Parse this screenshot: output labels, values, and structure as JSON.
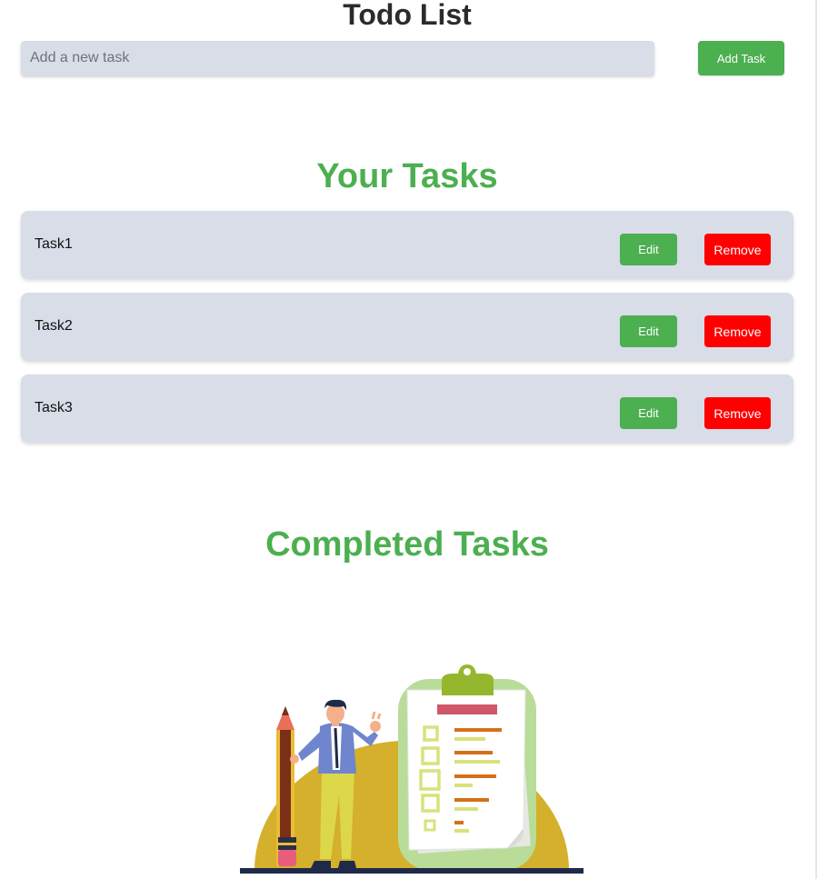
{
  "app": {
    "title": "Todo List"
  },
  "add_form": {
    "placeholder": "Add a new task",
    "value": "",
    "button_label": "Add Task"
  },
  "sections": {
    "your_tasks": "Your Tasks",
    "completed_tasks": "Completed Tasks"
  },
  "tasks": [
    {
      "name": "Task1",
      "edit_label": "Edit",
      "remove_label": "Remove"
    },
    {
      "name": "Task2",
      "edit_label": "Edit",
      "remove_label": "Remove"
    },
    {
      "name": "Task3",
      "edit_label": "Edit",
      "remove_label": "Remove"
    }
  ],
  "completed": [],
  "colors": {
    "accent": "#4caf50",
    "danger": "#ff0000",
    "card_bg": "#d8dde7",
    "title": "#2b2b2b"
  },
  "illustration": {
    "icon": "checklist-illustration"
  }
}
